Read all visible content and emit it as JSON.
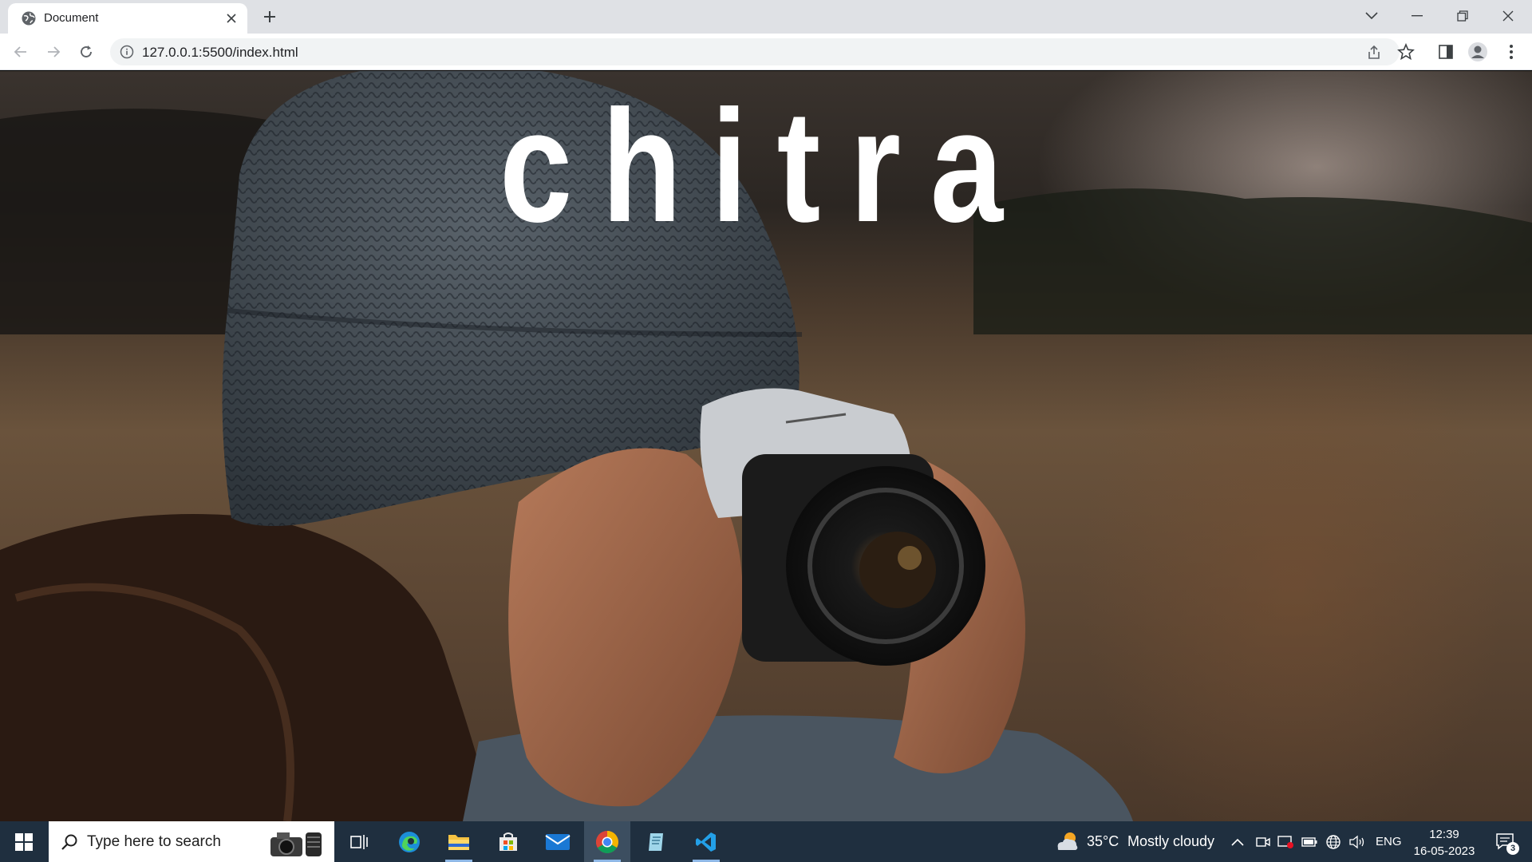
{
  "browser": {
    "tab_title": "Document",
    "url": "127.0.0.1:5500/index.html"
  },
  "page": {
    "heading": "chitra"
  },
  "taskbar": {
    "search_placeholder": "Type here to search",
    "weather_temp": "35°C",
    "weather_desc": "Mostly cloudy",
    "language": "ENG",
    "time": "12:39",
    "date": "16-05-2023",
    "notification_count": "3"
  },
  "colors": {
    "taskbar_bg": "#1f2f3f",
    "tabstrip_bg": "#dfe1e5",
    "heading": "#ffffff"
  }
}
